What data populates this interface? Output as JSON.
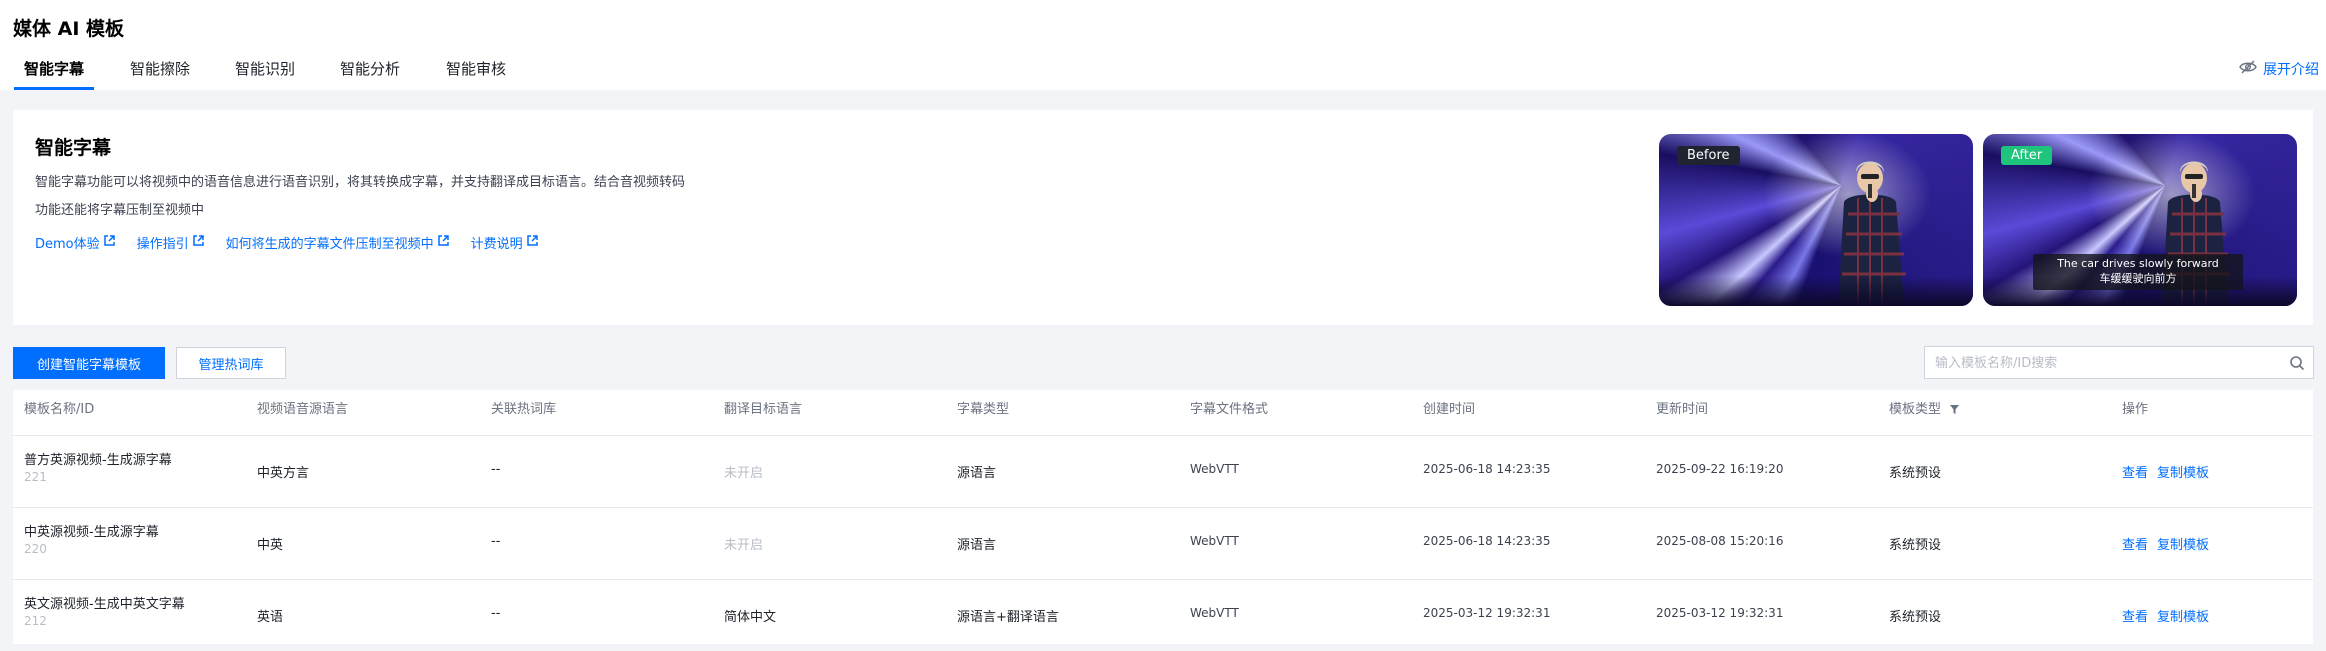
{
  "header": {
    "title": "媒体 AI 模板",
    "tabs": [
      {
        "label": "智能字幕",
        "active": true
      },
      {
        "label": "智能擦除",
        "active": false
      },
      {
        "label": "智能识别",
        "active": false
      },
      {
        "label": "智能分析",
        "active": false
      },
      {
        "label": "智能审核",
        "active": false
      }
    ],
    "expand_intro": "展开介绍"
  },
  "intro": {
    "title": "智能字幕",
    "description_line1": "智能字幕功能可以将视频中的语音信息进行语音识别，将其转换成字幕，并支持翻译成目标语言。结合音视频转码",
    "description_line2": "功能还能将字幕压制至视频中",
    "links": [
      "Demo体验",
      "操作指引",
      "如何将生成的字幕文件压制至视频中",
      "计费说明"
    ],
    "preview_before_label": "Before",
    "preview_after_label": "After",
    "subtitle_en": "The car drives slowly forward",
    "subtitle_zh": "车缓缓驶向前方"
  },
  "toolbar": {
    "create_button": "创建智能字幕模板",
    "manage_button": "管理热词库",
    "search_placeholder": "输入模板名称/ID搜索"
  },
  "table": {
    "columns": [
      "模板名称/ID",
      "视频语音源语言",
      "关联热词库",
      "翻译目标语言",
      "字幕类型",
      "字幕文件格式",
      "创建时间",
      "更新时间",
      "模板类型",
      "操作"
    ],
    "rows": [
      {
        "name": "普方英源视频-生成源字幕",
        "id": "221",
        "source_lang": "中英方言",
        "hotwords": "--",
        "target_lang": "未开启",
        "subtitle_type": "源语言",
        "format": "WebVTT",
        "created": "2025-06-18 14:23:35",
        "updated": "2025-09-22 16:19:20",
        "template_type": "系统预设",
        "op_view": "查看",
        "op_copy": "复制模板"
      },
      {
        "name": "中英源视频-生成源字幕",
        "id": "220",
        "source_lang": "中英",
        "hotwords": "--",
        "target_lang": "未开启",
        "subtitle_type": "源语言",
        "format": "WebVTT",
        "created": "2025-06-18 14:23:35",
        "updated": "2025-08-08 15:20:16",
        "template_type": "系统预设",
        "op_view": "查看",
        "op_copy": "复制模板"
      },
      {
        "name": "英文源视频-生成中英文字幕",
        "id": "212",
        "source_lang": "英语",
        "hotwords": "--",
        "target_lang": "简体中文",
        "subtitle_type": "源语言+翻译语言",
        "format": "WebVTT",
        "created": "2025-03-12 19:32:31",
        "updated": "2025-03-12 19:32:31",
        "template_type": "系统预设",
        "op_view": "查看",
        "op_copy": "复制模板"
      }
    ]
  },
  "colors": {
    "primary": "#006eff",
    "after_badge": "#1ec47c",
    "page_bg": "#f2f4f8"
  }
}
